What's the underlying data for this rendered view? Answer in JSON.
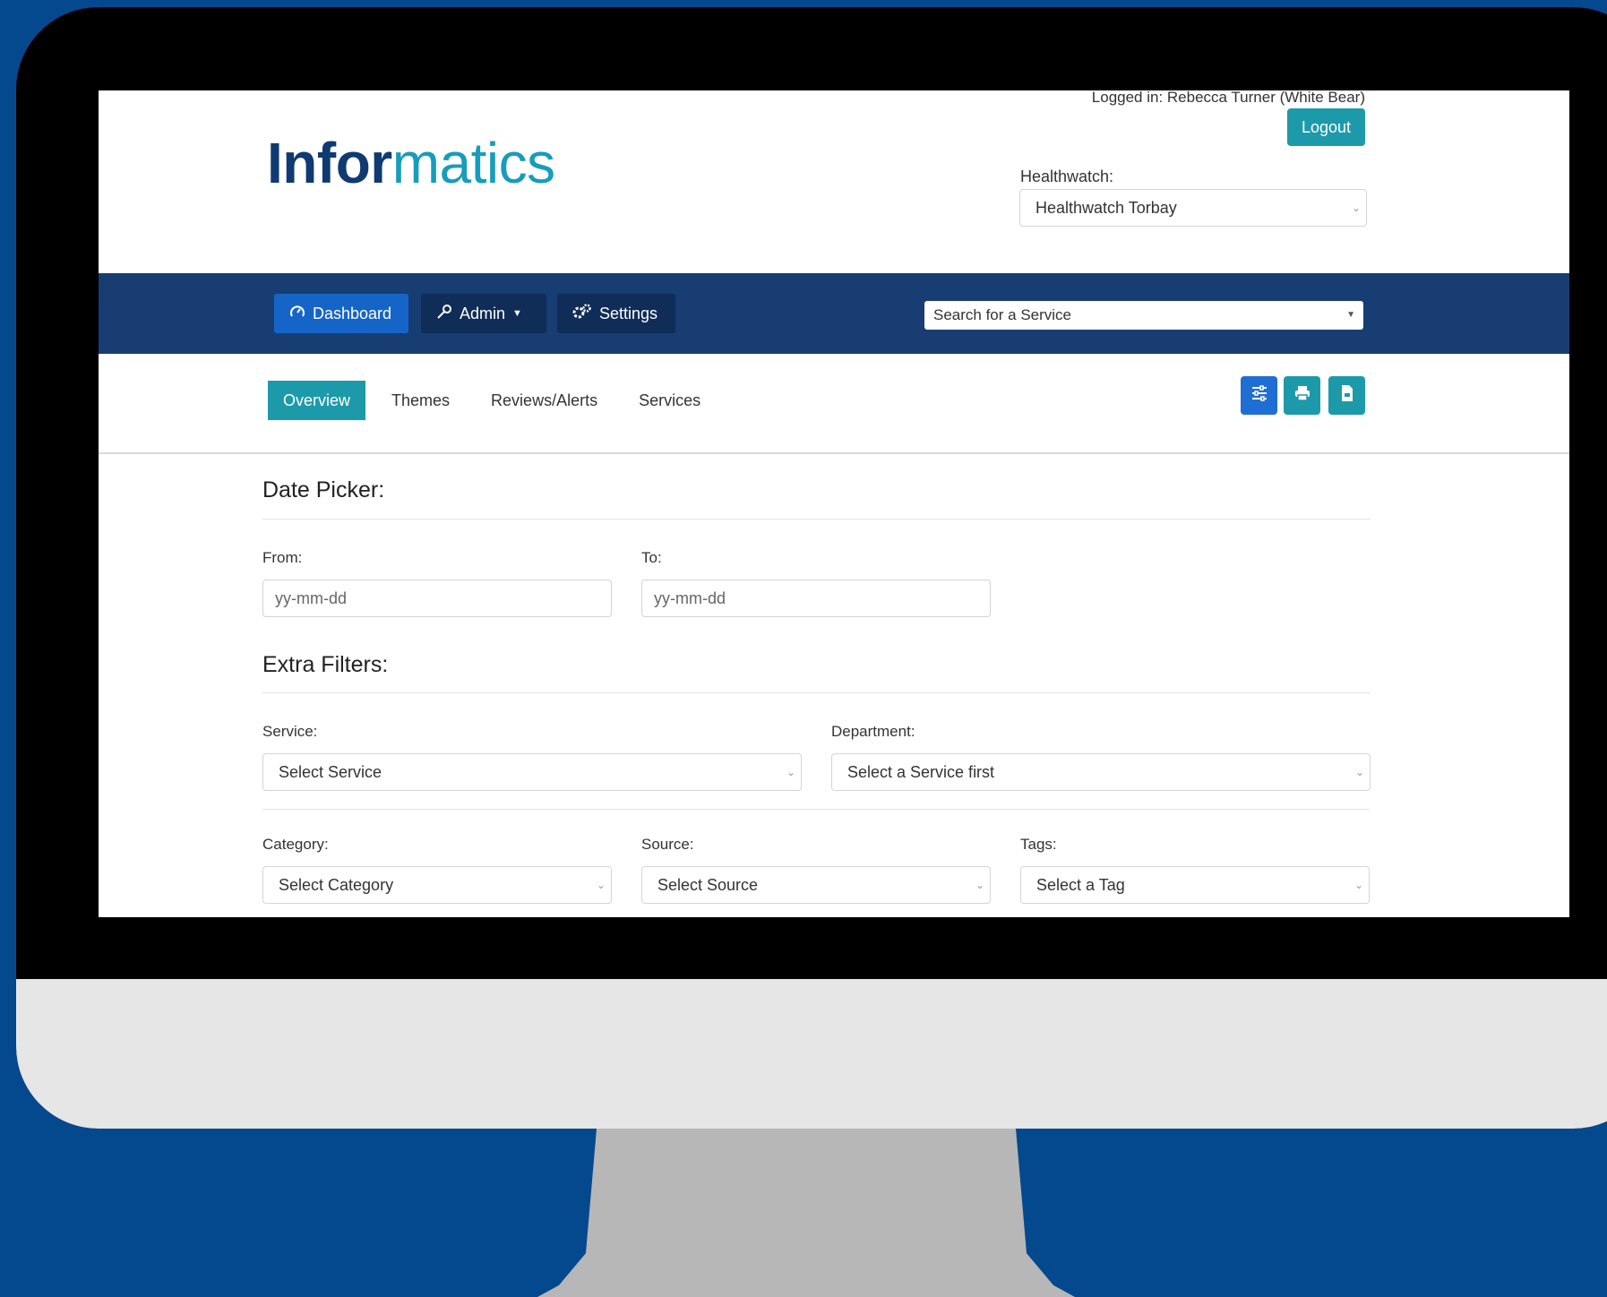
{
  "header": {
    "logged_in_text": "Logged in: Rebecca Turner (White Bear)",
    "logout_label": "Logout",
    "logo_part_a": "Infor",
    "logo_part_b": "matics",
    "healthwatch_label": "Healthwatch:",
    "healthwatch_value": "Healthwatch Torbay"
  },
  "nav": {
    "dashboard": "Dashboard",
    "admin": "Admin",
    "settings": "Settings",
    "search_placeholder": "Search for a Service"
  },
  "tabs": [
    {
      "label": "Overview",
      "active": true
    },
    {
      "label": "Themes"
    },
    {
      "label": "Reviews/Alerts"
    },
    {
      "label": "Services"
    }
  ],
  "toolbar": {
    "icons": [
      "sliders-icon",
      "print-icon",
      "file-icon"
    ]
  },
  "date_picker": {
    "title": "Date Picker:",
    "from_label": "From:",
    "to_label": "To:",
    "from_placeholder": "yy-mm-dd",
    "to_placeholder": "yy-mm-dd"
  },
  "filters": {
    "title": "Extra Filters:",
    "service_label": "Service:",
    "service_value": "Select Service",
    "department_label": "Department:",
    "department_value": "Select a Service first",
    "category_label": "Category:",
    "category_value": "Select Category",
    "source_label": "Source:",
    "source_value": "Select Source",
    "tags_label": "Tags:",
    "tags_value": "Select a Tag"
  },
  "colors": {
    "background": "#04498e",
    "navbar": "#173d73",
    "teal": "#1d9aaa",
    "blue_button": "#1565c8"
  }
}
